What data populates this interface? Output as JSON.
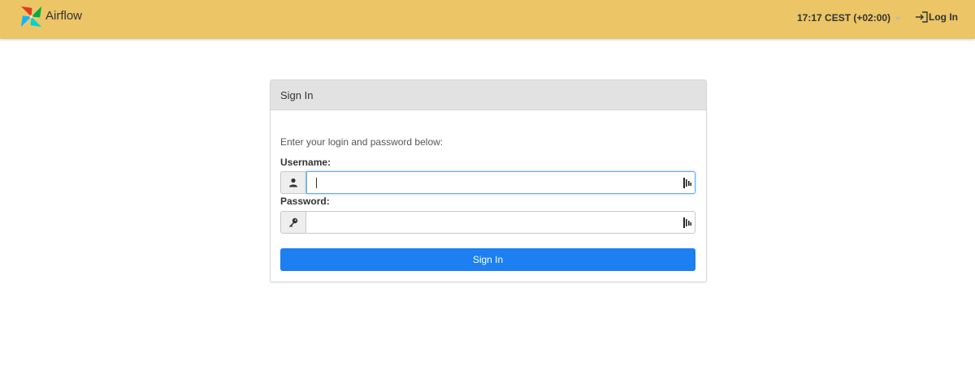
{
  "app": {
    "name": "Airflow"
  },
  "header": {
    "clock": "17:17 CEST (+02:00)",
    "login_label": "Log In"
  },
  "panel": {
    "title": "Sign In",
    "intro": "Enter your login and password below:",
    "username_label": "Username:",
    "username_value": "",
    "password_label": "Password:",
    "password_value": "",
    "submit_label": "Sign In"
  },
  "icons": {
    "logo": "airflow-pinwheel-icon",
    "clock_menu": "chevron-down-icon",
    "login": "sign-in-icon",
    "username": "user-icon",
    "password": "key-icon",
    "password_manager": "password-manager-icon"
  },
  "colors": {
    "navbar": "#ebc566",
    "primary_button": "#1c7ff2",
    "panel_heading": "#e2e2e2",
    "focus_border": "#66a8e8"
  }
}
